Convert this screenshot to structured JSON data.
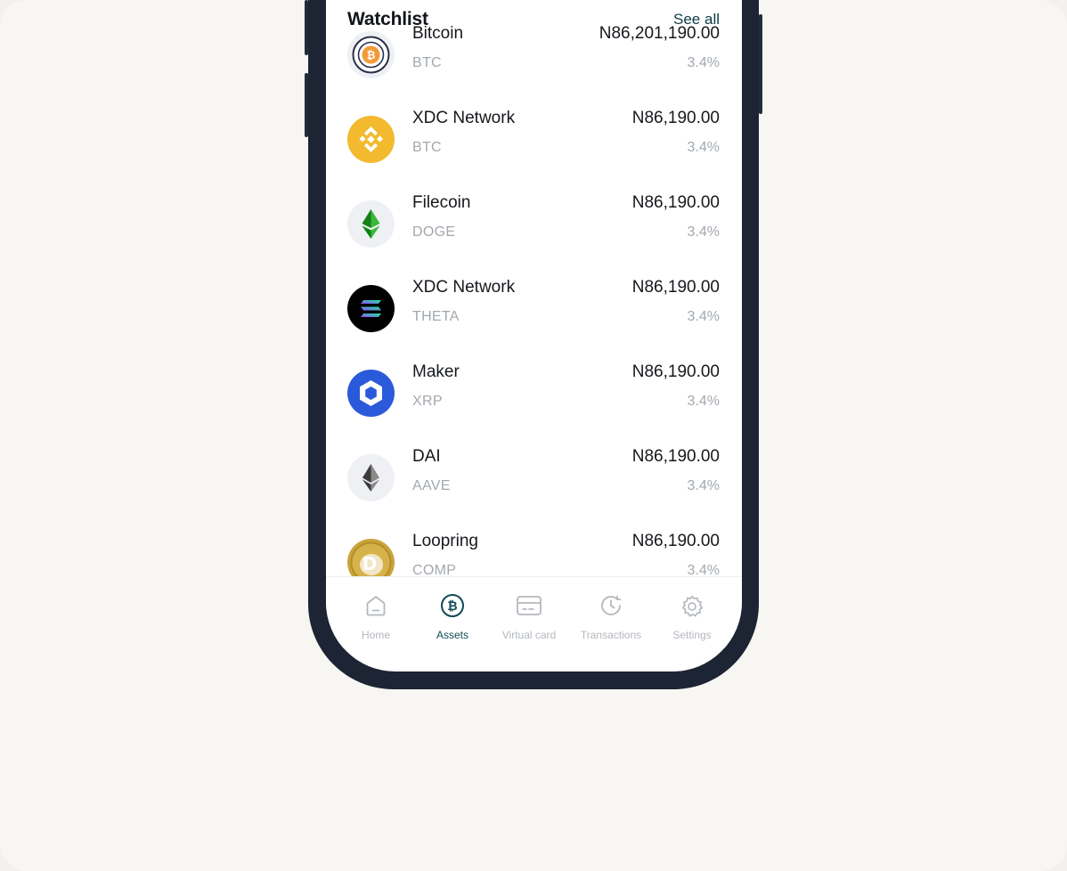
{
  "colors": {
    "accent": "#0e4a52",
    "muted": "#a3a8ae",
    "frame": "#1d2433",
    "background": "#f7f6f2"
  },
  "watchlist": {
    "title": "Watchlist",
    "see_all": "See all",
    "items": [
      {
        "name": "Bitcoin",
        "symbol": "BTC",
        "price": "N86,201,190.00",
        "change": "3.4%",
        "icon": "bitcoin-icon"
      },
      {
        "name": "XDC Network",
        "symbol": "BTC",
        "price": "N86,190.00",
        "change": "3.4%",
        "icon": "binance-icon"
      },
      {
        "name": "Filecoin",
        "symbol": "DOGE",
        "price": "N86,190.00",
        "change": "3.4%",
        "icon": "ethereum-classic-icon"
      },
      {
        "name": "XDC Network",
        "symbol": "THETA",
        "price": "N86,190.00",
        "change": "3.4%",
        "icon": "solana-icon"
      },
      {
        "name": "Maker",
        "symbol": "XRP",
        "price": "N86,190.00",
        "change": "3.4%",
        "icon": "chainlink-icon"
      },
      {
        "name": "DAI",
        "symbol": "AAVE",
        "price": "N86,190.00",
        "change": "3.4%",
        "icon": "ethereum-icon"
      },
      {
        "name": "Loopring",
        "symbol": "COMP",
        "price": "N86,190.00",
        "change": "3.4%",
        "icon": "dogecoin-icon"
      }
    ]
  },
  "nav": {
    "items": [
      {
        "label": "Home",
        "icon": "home-icon",
        "active": false
      },
      {
        "label": "Assets",
        "icon": "bitcoin-circle-icon",
        "active": true
      },
      {
        "label": "Virtual card",
        "icon": "card-icon",
        "active": false
      },
      {
        "label": "Transactions",
        "icon": "history-icon",
        "active": false
      },
      {
        "label": "Settings",
        "icon": "gear-icon",
        "active": false
      }
    ]
  }
}
